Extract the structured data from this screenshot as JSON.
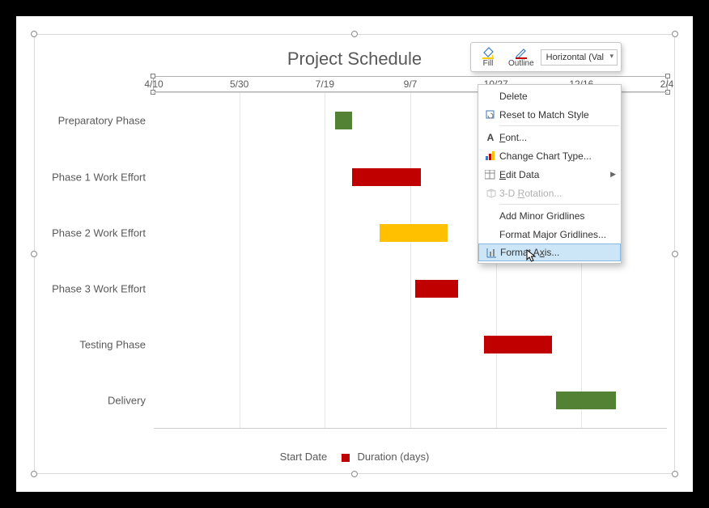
{
  "title": "Project Schedule",
  "legend": {
    "series1": "Start Date",
    "series2": "Duration (days)"
  },
  "axis_ticks": [
    "4/10",
    "5/30",
    "7/19",
    "9/7",
    "10/27",
    "12/16",
    "2/4"
  ],
  "tasks": [
    {
      "label": "Preparatory Phase",
      "start": "7/25",
      "duration": 10,
      "color": "#548235"
    },
    {
      "label": "Phase 1 Work Effort",
      "start": "8/4",
      "duration": 40,
      "color": "#c00000"
    },
    {
      "label": "Phase 2 Work Effort",
      "start": "8/20",
      "duration": 40,
      "color": "#ffc000"
    },
    {
      "label": "Phase 3 Work Effort",
      "start": "9/10",
      "duration": 25,
      "color": "#c00000"
    },
    {
      "label": "Testing Phase",
      "start": "10/20",
      "duration": 40,
      "color": "#c00000"
    },
    {
      "label": "Delivery",
      "start": "12/1",
      "duration": 35,
      "color": "#548235"
    }
  ],
  "mini_toolbar": {
    "fill": "Fill",
    "outline": "Outline",
    "dropdown": "Horizontal (Val"
  },
  "context_menu": {
    "delete": "Delete",
    "reset": "Reset to Match Style",
    "font": "Font...",
    "change_type": "Change Chart Type...",
    "edit_data": "Edit Data",
    "rotation": "3-D Rotation...",
    "add_minor": "Add Minor Gridlines",
    "format_major": "Format Major Gridlines...",
    "format_axis": "Format Axis..."
  },
  "context_menu_accel": {
    "font": "F",
    "change_type": "y",
    "edit_data": "E",
    "rotation": "R",
    "format_axis": "x"
  },
  "chart_data": {
    "type": "bar",
    "title": "Project Schedule",
    "xlabel": "",
    "ylabel": "",
    "x_ticks": [
      "4/10",
      "5/30",
      "7/19",
      "9/7",
      "10/27",
      "12/16",
      "2/4"
    ],
    "x_range_days": [
      0,
      300
    ],
    "categories": [
      "Preparatory Phase",
      "Phase 1 Work Effort",
      "Phase 2 Work Effort",
      "Phase 3 Work Effort",
      "Testing Phase",
      "Delivery"
    ],
    "series": [
      {
        "name": "Start Date",
        "role": "offset_days_from_4_10",
        "values": [
          106,
          116,
          132,
          153,
          193,
          235
        ]
      },
      {
        "name": "Duration (days)",
        "role": "length_days",
        "values": [
          10,
          40,
          40,
          25,
          40,
          35
        ]
      }
    ],
    "bar_colors": [
      "#548235",
      "#c00000",
      "#ffc000",
      "#c00000",
      "#c00000",
      "#548235"
    ],
    "legend_position": "bottom",
    "grid": {
      "x": true,
      "y": false
    }
  }
}
